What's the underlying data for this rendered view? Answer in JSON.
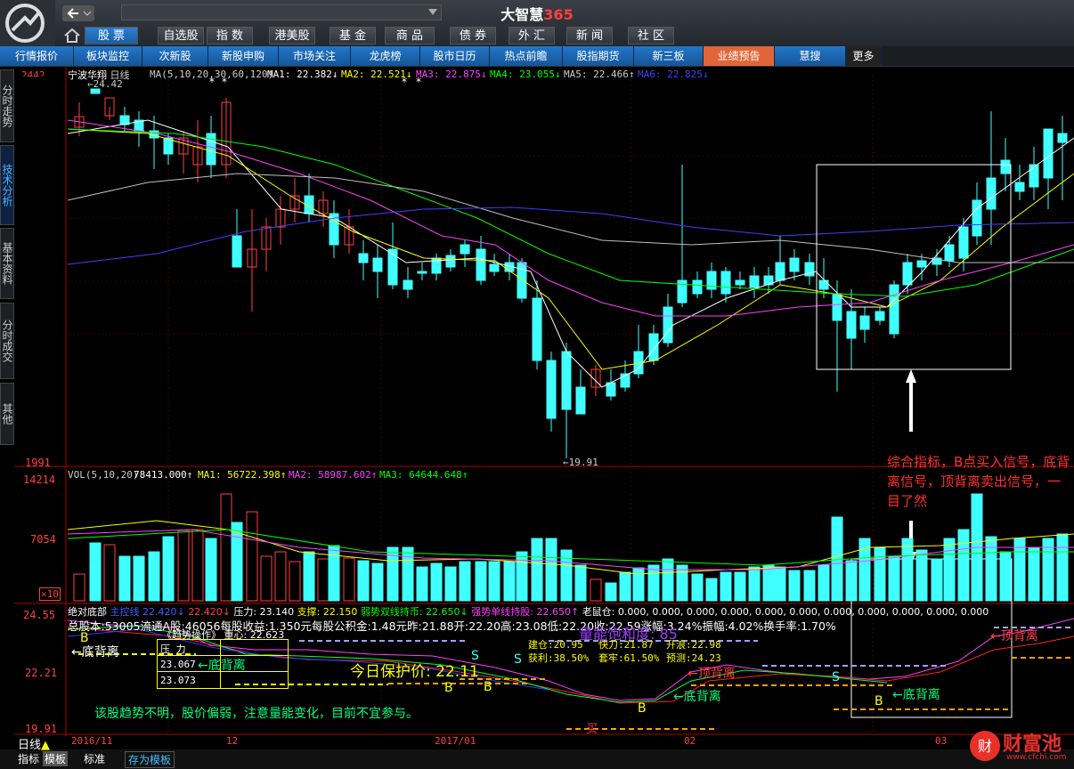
{
  "app": {
    "title": "大智慧",
    "title_suffix": "365"
  },
  "nav_main": [
    "股 票",
    "自选股",
    "指 数",
    "港美股",
    "基 金",
    "商 品",
    "债 券",
    "外 汇",
    "新 闻",
    "社 区"
  ],
  "nav_sub": [
    "行情报价",
    "板块监控",
    "次新股",
    "新股申购",
    "市场关注",
    "龙虎榜",
    "股市日历",
    "热点前瞻",
    "股指期货",
    "新三板",
    "业绩预告",
    "慧搜",
    "更多"
  ],
  "side_tabs": [
    "分时走势",
    "技术分析",
    "基本资料",
    "分时成交",
    "其他"
  ],
  "price_panel": {
    "stock": "宁波华翔",
    "period": "日线",
    "ma_label": "MA(5,10,20,30,60,120)",
    "ma1": "MA1: 22.382↓",
    "ma2": "MA2: 22.521↓",
    "ma3": "MA3: 22.875↓",
    "ma4": "MA4: 23.055↓",
    "ma5": "MA5: 22.466↑",
    "ma6": "MA6: 22.825↓",
    "high_mark": "24.42",
    "low_mark": "19.91",
    "y_bottom": "1991",
    "y_top": "2442",
    "annotation": "综合指标，B点买入信号，底背离信号，顶背离卖出信号，一目了然"
  },
  "vol_panel": {
    "label": "VOL(5,10,20)",
    "vol": "78413.000↑",
    "ma1": "MA1: 56722.398↑",
    "ma2": "MA2: 58987.602↑",
    "ma3": "MA3: 64644.648↑",
    "y_top": "14214",
    "y_mid": "7054",
    "x10": "×10"
  },
  "ind_panel": {
    "row1": [
      "绝对底部",
      "主控线",
      "22.420↓",
      "22.420↓",
      "压力: 23.140",
      "支撑: 22.150",
      "弱势双线持币: 22.650↓",
      "强势单线持股: 22.650↑",
      "老鼠仓: 0.000, 0.000, 0.000, 0.000,",
      "0.000, 0.000, 0.000, 0.000, 0.000, 0.000, 0.000"
    ],
    "row2": "总股本:53005流通A股:46056每股收益:1.350元每股公积金:1.48元昨:21.88开:22.20高:23.08低:22.20收:22.59涨幅:3.24%振幅:4.02%换手率:1.70%",
    "trend_title": "《趋势操作》 重心: 22.623",
    "table": [
      [
        "压 力",
        ""
      ],
      [
        "23.067",
        ""
      ],
      [
        "23.073",
        ""
      ]
    ],
    "stats": [
      [
        "建仓:20.95",
        "快刀:21.87",
        "升浪:22.98"
      ],
      [
        "获利:38.50%",
        "套牢:61.50%",
        "预测:24.23"
      ]
    ],
    "protect": "今日保护价: 22.11",
    "energy": "量能饱和度: 85",
    "advice": "该股趋势不明，股价偏弱，注意量能变化，目前不宜参与。",
    "y_top": "24.55",
    "y_mid": "22.21",
    "y_bot": "19.91",
    "labels_bottom_div": "←底背离",
    "labels_top_div": "←顶背离",
    "b_label": "B",
    "s_label": "S",
    "buy": "买"
  },
  "x_axis": [
    "2016/11",
    "12",
    "2017/01",
    "02",
    "03"
  ],
  "bottom_tabs": [
    "日线",
    "指标",
    "模板",
    "标准",
    "存为模板"
  ],
  "watermark": {
    "text": "财富池",
    "url": "www.cfchi.com"
  },
  "colors": {
    "up": "#ff4040",
    "down": "#40ffff",
    "ma1": "#ffffff",
    "ma2": "#ffff00",
    "ma3": "#ff40ff",
    "ma4": "#00ff00",
    "ma5": "#c0c0c0",
    "ma6": "#4040ff"
  }
}
